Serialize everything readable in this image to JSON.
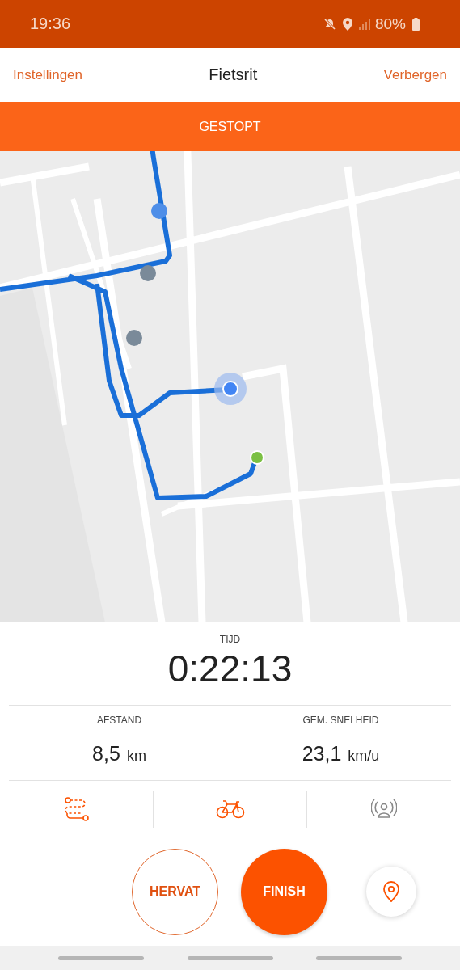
{
  "status_bar": {
    "time": "19:36",
    "battery": "80%"
  },
  "header": {
    "left": "Instellingen",
    "title": "Fietsrit",
    "right": "Verbergen"
  },
  "banner": {
    "text": "GESTOPT"
  },
  "time": {
    "label": "TIJD",
    "value": "0:22:13"
  },
  "stats": [
    {
      "label": "AFSTAND",
      "value": "8,5",
      "unit": "km"
    },
    {
      "label": "GEM. SNELHEID",
      "value": "23,1",
      "unit": "km/u"
    }
  ],
  "tools": [
    {
      "kind": "route",
      "on": true
    },
    {
      "kind": "bike",
      "on": true
    },
    {
      "kind": "beacon",
      "on": false
    }
  ],
  "buttons": [
    {
      "kind": "outline",
      "label": "HERVAT"
    },
    {
      "kind": "filled",
      "label": "FINISH"
    }
  ]
}
